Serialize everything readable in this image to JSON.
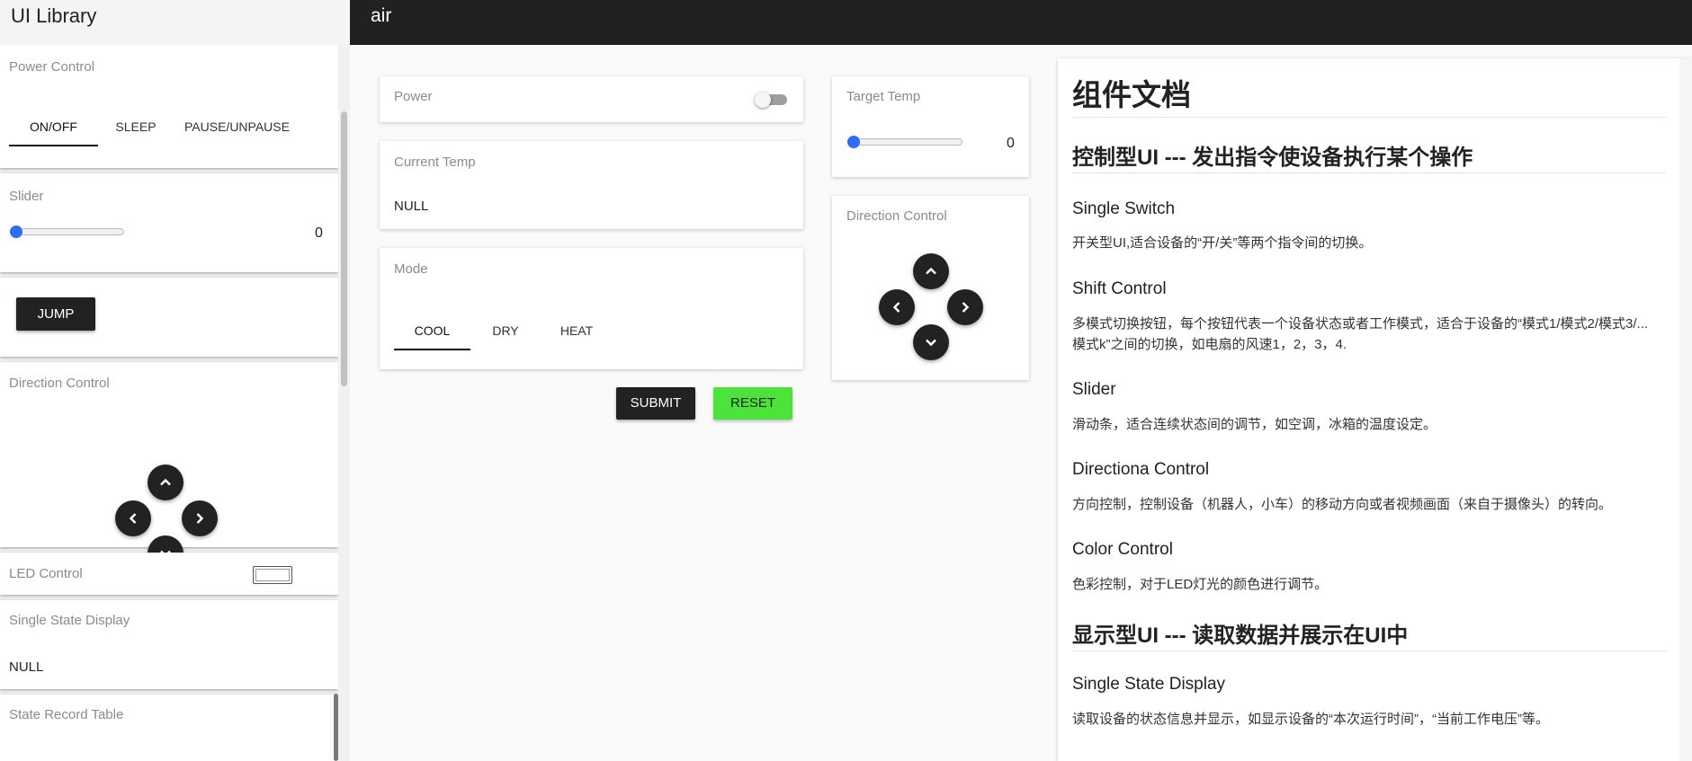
{
  "sidebar": {
    "title": "UI Library",
    "power_control": {
      "label": "Power Control",
      "tabs": [
        "ON/OFF",
        "SLEEP",
        "PAUSE/UNPAUSE"
      ]
    },
    "slider": {
      "label": "Slider",
      "value": "0"
    },
    "jump_button": "JUMP",
    "direction_control": {
      "label": "Direction Control"
    },
    "led_control": {
      "label": "LED Control"
    },
    "single_state_display": {
      "label": "Single State Display",
      "value": "NULL"
    },
    "state_record_table": {
      "label": "State Record Table"
    }
  },
  "topbar": {
    "title": "air"
  },
  "main": {
    "power": {
      "label": "Power"
    },
    "current_temp": {
      "label": "Current Temp",
      "value": "NULL"
    },
    "mode": {
      "label": "Mode",
      "tabs": [
        "COOL",
        "DRY",
        "HEAT"
      ]
    },
    "submit_label": "SUBMIT",
    "reset_label": "RESET",
    "target_temp": {
      "label": "Target Temp",
      "value": "0"
    },
    "direction_control": {
      "label": "Direction Control"
    }
  },
  "docs": {
    "title": "组件文档",
    "section_control": "控制型UI --- 发出指令使设备执行某个操作",
    "single_switch": {
      "title": "Single Switch",
      "desc": "开关型UI,适合设备的“开/关”等两个指令间的切换。"
    },
    "shift_control": {
      "title": "Shift Control",
      "desc": "多模式切换按钮，每个按钮代表一个设备状态或者工作模式，适合于设备的“模式1/模式2/模式3/...模式k”之间的切换，如电扇的风速1，2，3，4."
    },
    "slider": {
      "title": "Slider",
      "desc": "滑动条，适合连续状态间的调节，如空调，冰箱的温度设定。"
    },
    "direction_control": {
      "title": "Directiona Control",
      "desc": "方向控制，控制设备（机器人，小车）的移动方向或者视频画面（来自于摄像头）的转向。"
    },
    "color_control": {
      "title": "Color Control",
      "desc": "色彩控制，对于LED灯光的颜色进行调节。"
    },
    "section_display": "显示型UI --- 读取数据并展示在UI中",
    "single_state_display": {
      "title": "Single State Display",
      "desc": "读取设备的状态信息并显示，如显示设备的“本次运行时间”，“当前工作电压”等。"
    }
  },
  "colors": {
    "topbar": "#212121",
    "accent_blue": "#2d6cf5",
    "reset_green": "#4ce33a",
    "dark_button": "#222222"
  },
  "icons": [
    "chevron-up-icon",
    "chevron-down-icon",
    "chevron-left-icon",
    "chevron-right-icon"
  ]
}
